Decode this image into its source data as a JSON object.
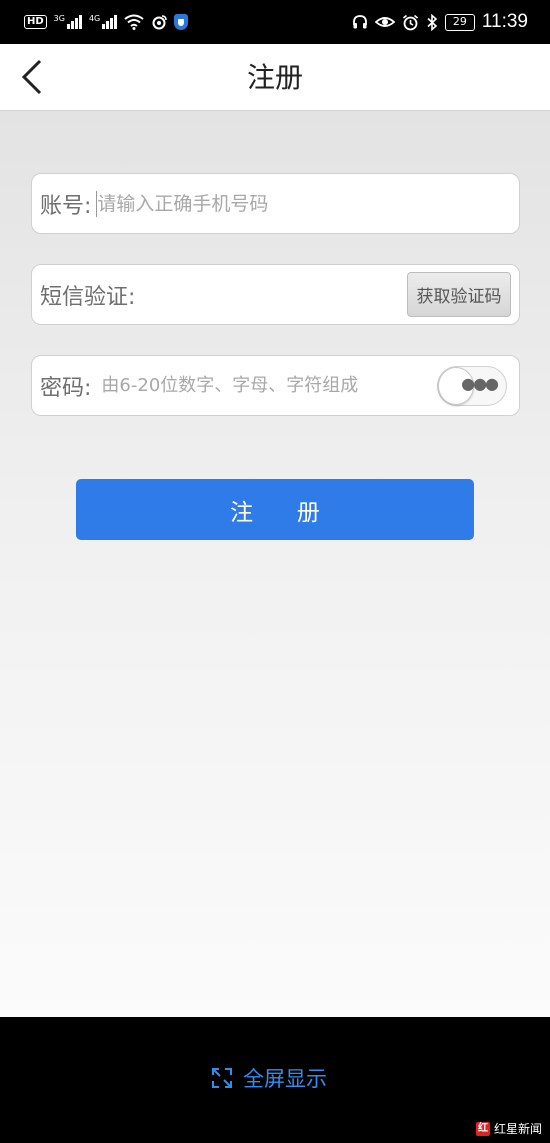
{
  "status_bar": {
    "hd": "HD",
    "net1": "3G",
    "net2": "4G",
    "battery": "29",
    "time": "11:39"
  },
  "header": {
    "title": "注册"
  },
  "form": {
    "account_label": "账号:",
    "account_placeholder": "请输入正确手机号码",
    "sms_label": "短信验证:",
    "get_code_label": "获取验证码",
    "password_label": "密码:",
    "password_placeholder": "由6-20位数字、字母、字符组成",
    "password_visible": false
  },
  "submit_label": "注      册",
  "bottom": {
    "fullscreen_label": "全屏显示"
  },
  "watermark": {
    "logo_text": "红",
    "text": "红星新闻"
  },
  "colors": {
    "accent": "#2f7ce8",
    "link": "#2f8ff0"
  }
}
